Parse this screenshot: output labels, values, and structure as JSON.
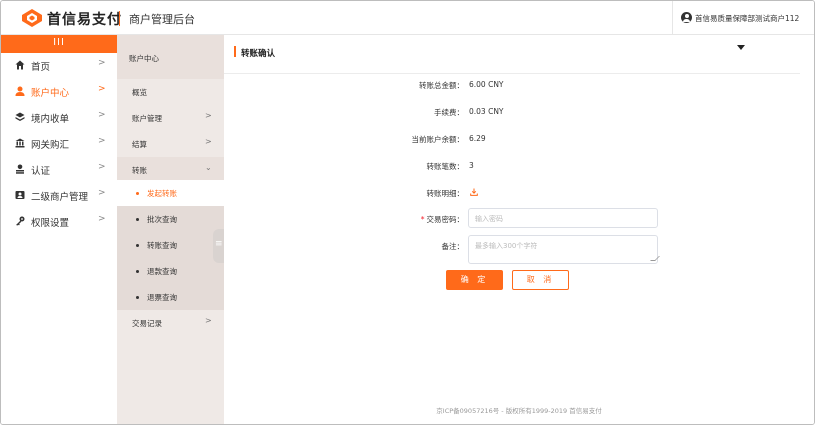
{
  "header": {
    "brand": "首信易支付",
    "subtitle": "商户管理后台",
    "user_name": "首信易质量保障部测试商户112",
    "accent_color": "#ff6a1a"
  },
  "sidebar": {
    "toggle_label": "III",
    "items": [
      {
        "label": "首页",
        "icon": "home-icon",
        "arrow": ">"
      },
      {
        "label": "账户中心",
        "icon": "user-icon",
        "arrow": ">",
        "active": true
      },
      {
        "label": "境内收单",
        "icon": "layers-icon",
        "arrow": ">"
      },
      {
        "label": "网关购汇",
        "icon": "bank-icon",
        "arrow": ">"
      },
      {
        "label": "认证",
        "icon": "person-icon",
        "arrow": ">"
      },
      {
        "label": "二级商户管理",
        "icon": "id-card-icon",
        "arrow": ">"
      },
      {
        "label": "权限设置",
        "icon": "key-icon",
        "arrow": ">"
      }
    ]
  },
  "submenu": {
    "header": "账户中心",
    "items": [
      {
        "label": "概览",
        "arrow": ""
      },
      {
        "label": "账户管理",
        "arrow": ">"
      },
      {
        "label": "结算",
        "arrow": ">"
      },
      {
        "label": "转账",
        "arrow": "⌄"
      }
    ],
    "transfer_children": [
      {
        "label": "发起转账",
        "active": true
      },
      {
        "label": "批次查询"
      },
      {
        "label": "转账查询"
      },
      {
        "label": "退款查询"
      },
      {
        "label": "退票查询"
      }
    ],
    "trailing": {
      "label": "交易记录",
      "arrow": ">"
    }
  },
  "main": {
    "title": "转账确认",
    "rows": [
      {
        "label": "转账总金额：",
        "value": "6.00 CNY"
      },
      {
        "label": "手续费：",
        "value": "0.03 CNY"
      },
      {
        "label": "当前账户余额：",
        "value": "6.29"
      },
      {
        "label": "转账笔数：",
        "value": "3"
      },
      {
        "label": "转账明细：",
        "value": ""
      }
    ],
    "password": {
      "required_mark": "*",
      "label": "交易密码：",
      "placeholder": "输入密码"
    },
    "note": {
      "label": "备注：",
      "placeholder": "最多输入300个字符"
    },
    "confirm_label": "确 定",
    "cancel_label": "取 消",
    "footer": "京ICP备09057216号 - 版权所有1999-2019 首信易支付"
  }
}
